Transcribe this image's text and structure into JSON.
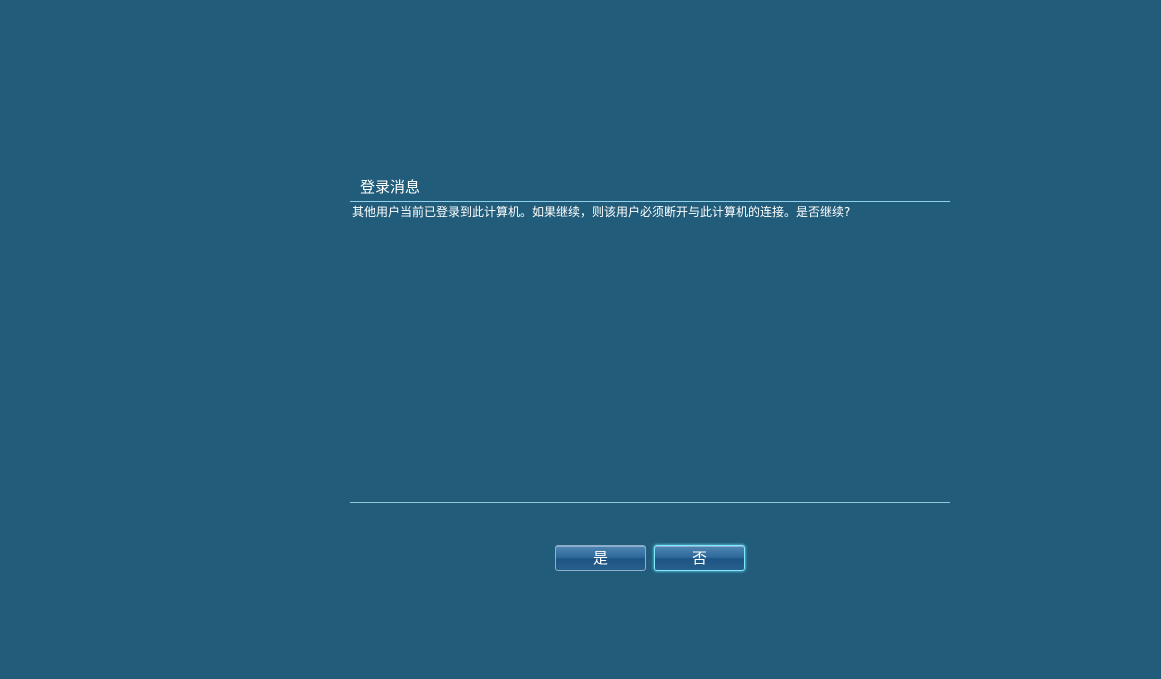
{
  "dialog": {
    "title": "登录消息",
    "message": "其他用户当前已登录到此计算机。如果继续，则该用户必须断开与此计算机的连接。是否继续?"
  },
  "buttons": {
    "yes_label": "是",
    "no_label": "否"
  },
  "colors": {
    "background": "#215d7a",
    "divider": "#8fd0ea",
    "focus_border": "#7fe9ff"
  }
}
